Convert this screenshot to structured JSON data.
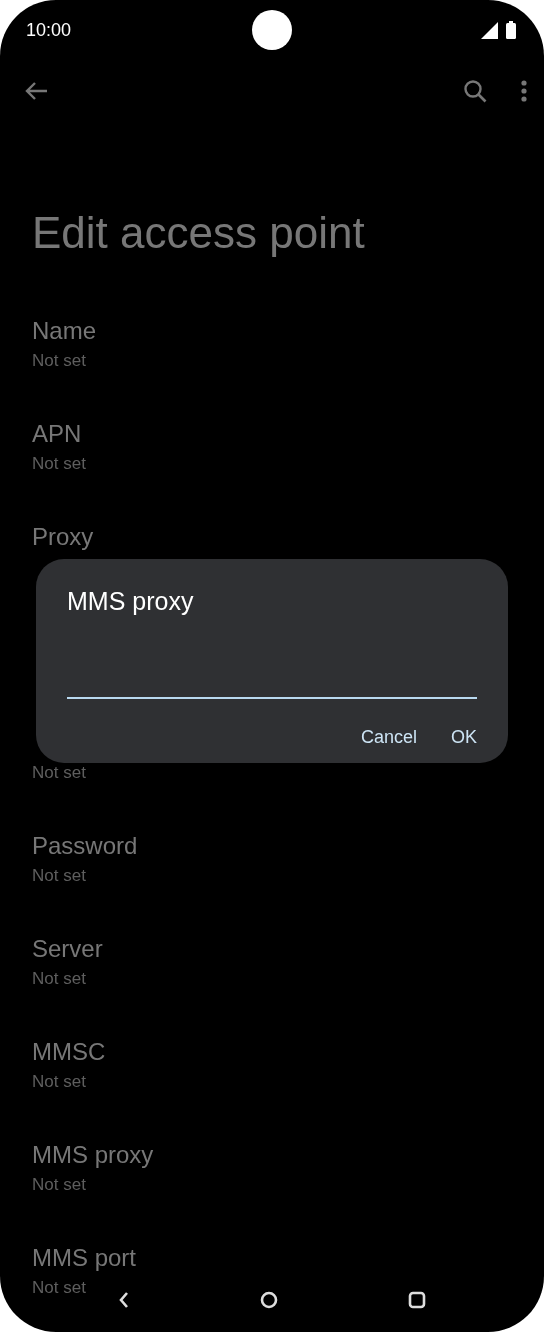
{
  "status_bar": {
    "time": "10:00"
  },
  "app_bar": {
    "title": "Edit access point"
  },
  "settings": [
    {
      "kind": "setting",
      "title": "Name",
      "value": "Not set"
    },
    {
      "kind": "setting",
      "title": "APN",
      "value": "Not set"
    },
    {
      "kind": "setting",
      "title": "Proxy"
    },
    {
      "kind": "covered"
    },
    {
      "kind": "setting",
      "value": "Not set"
    },
    {
      "kind": "setting",
      "title": "Password",
      "value": "Not set"
    },
    {
      "kind": "setting",
      "title": "Server",
      "value": "Not set"
    },
    {
      "kind": "setting",
      "title": "MMSC",
      "value": "Not set"
    },
    {
      "kind": "setting",
      "title": "MMS proxy",
      "value": "Not set"
    },
    {
      "kind": "setting",
      "title": "MMS port",
      "value": "Not set"
    }
  ],
  "dialog": {
    "title": "MMS proxy",
    "input": {
      "focused": true
    },
    "buttons": [
      "Cancel",
      "OK"
    ]
  }
}
